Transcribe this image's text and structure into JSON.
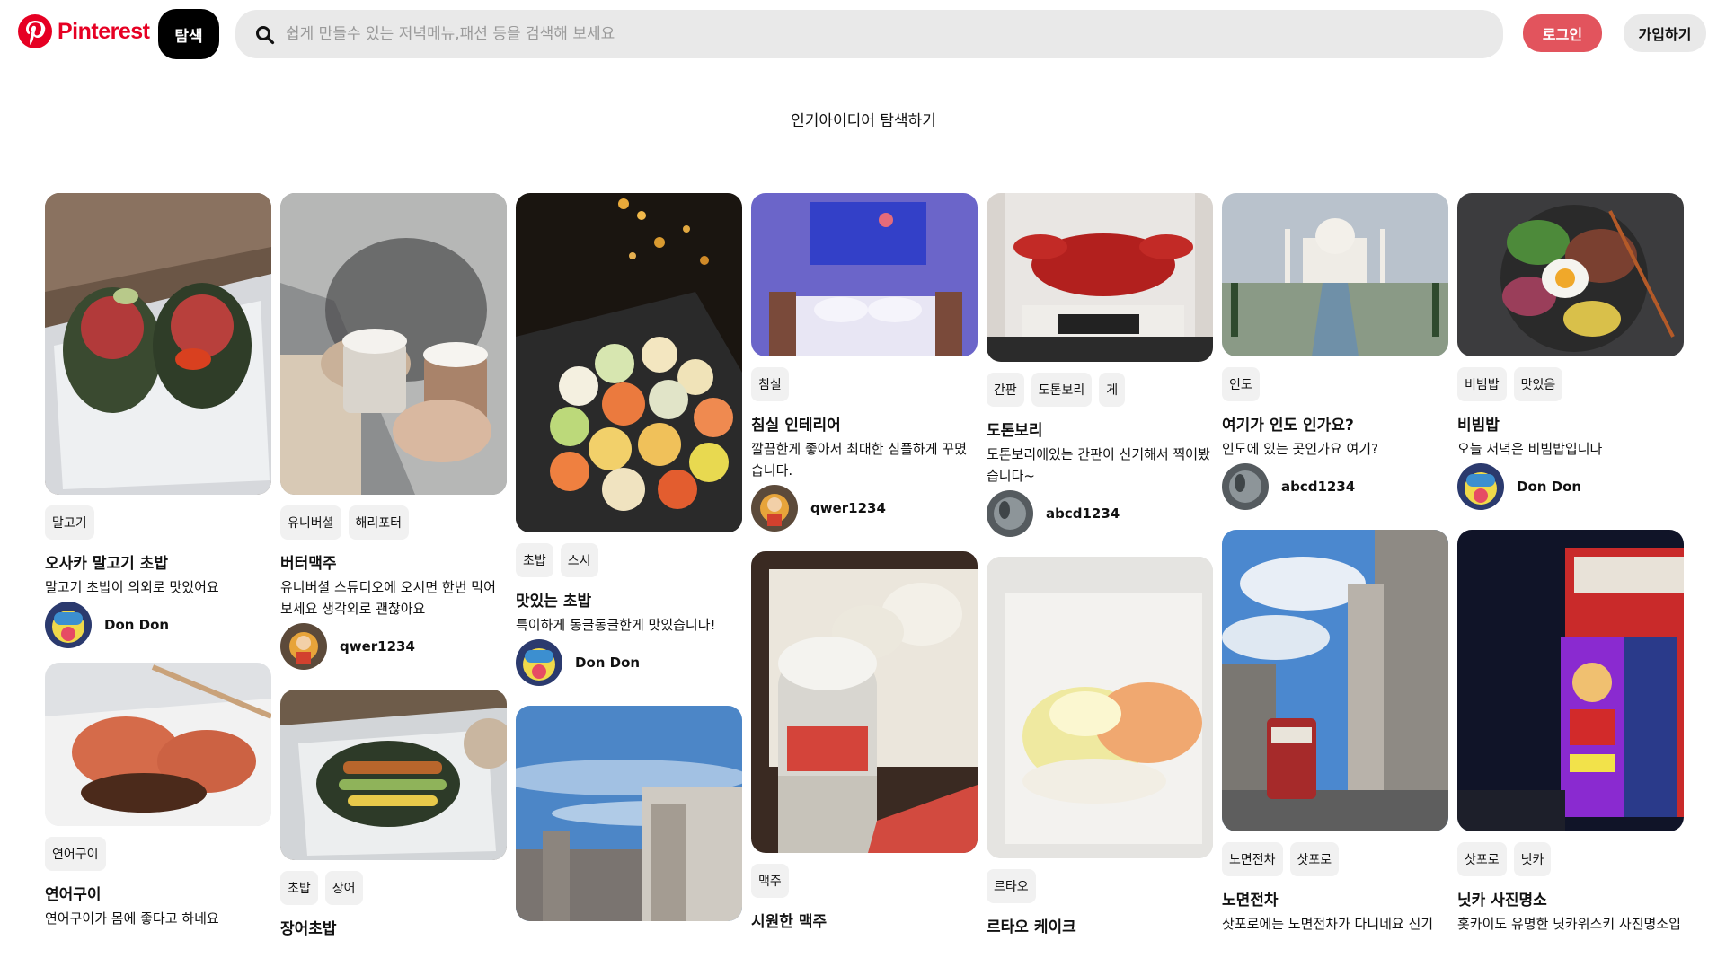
{
  "brand": {
    "name": "Pinterest",
    "color": "#e60023"
  },
  "header": {
    "explore_label": "탐색",
    "search_placeholder": "쉽게 만들수 있는 저녁메뉴,패션 등을 검색해 보세요",
    "login_label": "로그인",
    "signup_label": "가입하기"
  },
  "section_title": "인기아이디어 탐색하기",
  "columns": [
    [
      {
        "tags": [
          "말고기"
        ],
        "title": "오사카 말고기 초밥",
        "desc": "말고기 초밥이 의외로 맛있어요",
        "author": "Don Don"
      },
      {
        "tags": [
          "연어구이"
        ],
        "title": "연어구이",
        "desc": "연어구이가 몸에 좋다고 하네요",
        "author": ""
      }
    ],
    [
      {
        "tags": [
          "유니버셜",
          "해리포터"
        ],
        "title": "버터맥주",
        "desc": "유니버셜 스튜디오에 오시면 한번 먹어보세요 생각외로 괜찮아요",
        "author": "qwer1234"
      },
      {
        "tags": [
          "초밥",
          "장어"
        ],
        "title": "장어초밥",
        "desc": "",
        "author": ""
      }
    ],
    [
      {
        "tags": [
          "초밥",
          "스시"
        ],
        "title": "맛있는 초밥",
        "desc": "특이하게 동글동글한게 맛있습니다!",
        "author": "Don Don"
      },
      {
        "tags": [],
        "title": "",
        "desc": "",
        "author": ""
      }
    ],
    [
      {
        "tags": [
          "침실"
        ],
        "title": "침실 인테리어",
        "desc": "깔끔한게 좋아서 최대한 심플하게 꾸몄습니다.",
        "author": "qwer1234"
      },
      {
        "tags": [
          "맥주"
        ],
        "title": "시원한 맥주",
        "desc": "",
        "author": ""
      }
    ],
    [
      {
        "tags": [
          "간판",
          "도톤보리",
          "게"
        ],
        "title": "도톤보리",
        "desc": "도톤보리에있는 간판이 신기해서 찍어봤습니다~",
        "author": "abcd1234"
      },
      {
        "tags": [
          "르타오"
        ],
        "title": "르타오 케이크",
        "desc": "",
        "author": ""
      }
    ],
    [
      {
        "tags": [
          "인도"
        ],
        "title": "여기가 인도 인가요?",
        "desc": "인도에 있는 곳인가요 여기?",
        "author": "abcd1234"
      },
      {
        "tags": [
          "노면전차",
          "삿포로"
        ],
        "title": "노면전차",
        "desc": "삿포로에는 노면전차가 다니네요 신기",
        "author": ""
      }
    ],
    [
      {
        "tags": [
          "비빔밥",
          "맛있음"
        ],
        "title": "비빔밥",
        "desc": "오늘 저녁은 비빔밥입니다",
        "author": "Don Don"
      },
      {
        "tags": [
          "삿포로",
          "닛카"
        ],
        "title": "닛카 사진명소",
        "desc": "홋카이도 유명한 닛카위스키 사진명소입",
        "author": ""
      }
    ]
  ]
}
